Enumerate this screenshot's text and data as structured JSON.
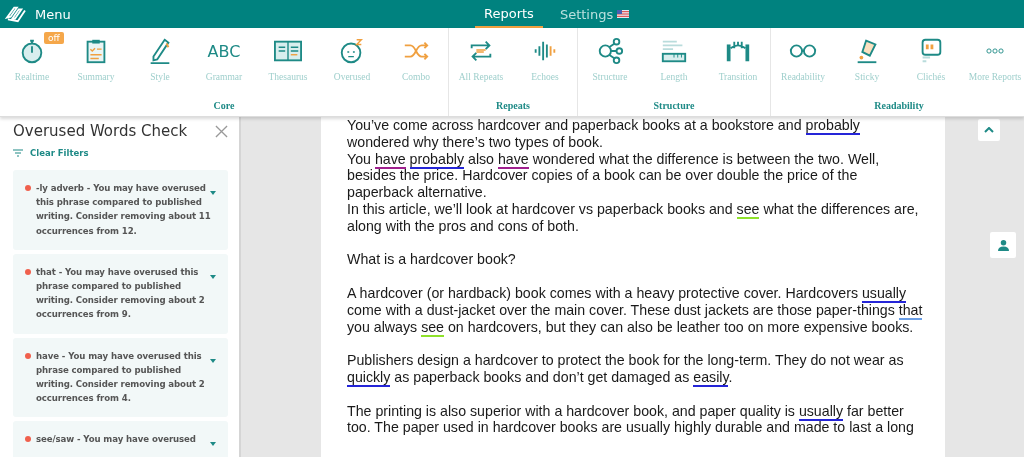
{
  "app_bar": {
    "menu_label": "Menu",
    "tabs": [
      {
        "label": "Reports",
        "selected": true,
        "flag": false
      },
      {
        "label": "Settings",
        "selected": false,
        "flag": true
      }
    ]
  },
  "toolbar": {
    "groups": [
      {
        "label": "Core",
        "items": [
          {
            "label": "Realtime",
            "kind": "timer",
            "badge": "off"
          },
          {
            "label": "Summary",
            "kind": "clipboard"
          },
          {
            "label": "Style",
            "kind": "pen"
          },
          {
            "label": "Grammar",
            "kind": "abc",
            "icon_text": "ABC"
          },
          {
            "label": "Thesaurus",
            "kind": "book"
          },
          {
            "label": "Overused",
            "kind": "face"
          },
          {
            "label": "Combo",
            "kind": "shuffle"
          }
        ]
      },
      {
        "label": "Repeats",
        "items": [
          {
            "label": "All Repeats",
            "kind": "repeat"
          },
          {
            "label": "Echoes",
            "kind": "wave"
          }
        ]
      },
      {
        "label": "Structure",
        "items": [
          {
            "label": "Structure",
            "kind": "nodes"
          },
          {
            "label": "Length",
            "kind": "ruler"
          },
          {
            "label": "Transition",
            "kind": "bridge"
          }
        ]
      },
      {
        "label": "Readability",
        "items": [
          {
            "label": "Readability",
            "kind": "glasses"
          },
          {
            "label": "Sticky",
            "kind": "tag"
          },
          {
            "label": "Clichés",
            "kind": "quote"
          },
          {
            "label": "More Reports",
            "kind": "dots"
          }
        ]
      }
    ]
  },
  "sidebar": {
    "title": "Overused Words Check",
    "filter_label": "Clear Filters",
    "issues": [
      {
        "text": "-ly adverb - You may have overused this phrase compared to published writing. Consider removing about 11 occurrences from 12.",
        "color": "#f0604d"
      },
      {
        "text": "that - You may have overused this phrase compared to published writing. Consider removing about 2 occurrences from 9.",
        "color": "#f0604d"
      },
      {
        "text": "have - You may have overused this phrase compared to published writing. Consider removing about 2 occurrences from 4.",
        "color": "#f0604d"
      },
      {
        "text": "see/saw - You may have overused",
        "color": "#f0604d"
      }
    ]
  },
  "document": {
    "blocks": [
      [
        {
          "segments": [
            {
              "text": "You’ve come across hardcover and paperback books at a bookstore and "
            },
            {
              "text": "probably",
              "color": "#2525d8"
            },
            {
              "text": " wondered why there’s two types of book."
            }
          ]
        },
        {
          "segments": [
            {
              "text": "You "
            },
            {
              "text": "have",
              "color": "#a0208f",
              "space_after": true
            },
            {
              "text": "probably",
              "color": "#2525d8"
            },
            {
              "text": " also "
            },
            {
              "text": "have",
              "color": "#a0208f"
            },
            {
              "text": " wondered what the difference is between the two. Well, besides the price. Hardcover copies of a book can be over double the price of the paperback alternative."
            }
          ]
        },
        {
          "segments": [
            {
              "text": "In this article, we’ll look at hardcover vs paperback books and "
            },
            {
              "text": "see",
              "color": "#8fe22b"
            },
            {
              "text": " what the differences are, along with the pros and cons of both."
            }
          ]
        }
      ],
      [
        {
          "segments": [
            {
              "text": "What is a hardcover book?"
            }
          ]
        }
      ],
      [
        {
          "segments": [
            {
              "text": "A hardcover (or hardback) book comes with a heavy protective cover. Hardcovers "
            },
            {
              "text": "usually",
              "color": "#2525d8"
            },
            {
              "text": " come with a dust-jacket over the main cover. These dust jackets are those paper-things "
            },
            {
              "text": "that",
              "color": "#6a9ee6"
            },
            {
              "text": " you always "
            },
            {
              "text": "see",
              "color": "#8fe22b"
            },
            {
              "text": " on hardcovers, but they can also be leather too on more expensive books."
            }
          ]
        }
      ],
      [
        {
          "segments": [
            {
              "text": "Publishers design a hardcover to protect the book for the long-term. They do not wear as "
            },
            {
              "text": "quickly",
              "color": "#2525d8"
            },
            {
              "text": " as paperback books and don’t get damaged as "
            },
            {
              "text": "easily",
              "color": "#2525d8"
            },
            {
              "text": "."
            }
          ]
        }
      ],
      [
        {
          "segments": [
            {
              "text": "The printing is also superior with a hardcover book, and paper quality is "
            },
            {
              "text": "usually",
              "color": "#2525d8"
            },
            {
              "text": " far better too. The paper used in hardcover books are usually highly durable and made to last a long"
            }
          ]
        }
      ]
    ]
  }
}
